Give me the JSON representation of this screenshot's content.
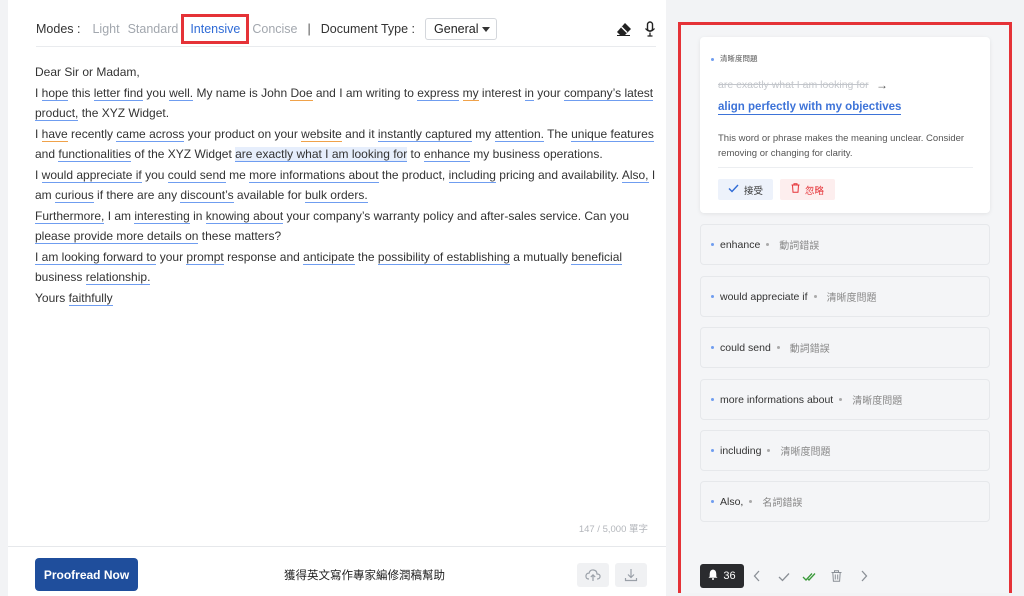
{
  "toolbar": {
    "modes_label": "Modes :",
    "modes": [
      {
        "label": "Light"
      },
      {
        "label": "Standard"
      },
      {
        "label": "Intensive",
        "active": true
      },
      {
        "label": "Concise"
      }
    ],
    "separator": "|",
    "doc_type_label": "Document Type :",
    "doc_type_value": "General",
    "icons": [
      "eraser-icon",
      "microphone-icon"
    ]
  },
  "document": {
    "greeting": "Dear Sir or Madam,",
    "lines": {
      "l1a": "I ",
      "l1b": "hope",
      "l1c": " this ",
      "l1d": "letter find",
      "l1e": " you ",
      "l1f": "well.",
      "l1g": " My name is John ",
      "l1h": "Doe",
      "l1i": " and I am writing to ",
      "l1j": "express",
      "l1k": " ",
      "l1l": "my",
      "l1m": " interest ",
      "l1n": "in",
      "l1o": " your ",
      "l1p": "company’s latest product,",
      "l1q": " the XYZ Widget.",
      "l2a": "I ",
      "l2b": "have",
      "l2c": " recently ",
      "l2d": "came across",
      "l2e": " your product on your ",
      "l2f": "website",
      "l2g": " and it ",
      "l2h": "instantly captured",
      "l2i": " my ",
      "l2j": "attention.",
      "l2k": " The ",
      "l2l": "unique features",
      "l2m": " and ",
      "l2n": "functionalities",
      "l2o": " of the XYZ Widget ",
      "l2p": "are exactly what I am looking for",
      "l2q": " to ",
      "l2r": "enhance",
      "l2s": " my business operations.",
      "l3a": "I ",
      "l3b": "would appreciate if",
      "l3c": " you ",
      "l3d": "could send",
      "l3e": " me ",
      "l3f": "more informations about",
      "l3g": " the product, ",
      "l3h": "including",
      "l3i": " pricing and availability. ",
      "l3j": "Also,",
      "l3k": " I am ",
      "l3l": "curious",
      "l3m": " if there are any ",
      "l3n": "discount’s",
      "l3o": " available for ",
      "l3p": "bulk orders.",
      "l4a": "Furthermore,",
      "l4b": " I am ",
      "l4c": "interesting",
      "l4d": " in ",
      "l4e": "knowing about",
      "l4f": " your company’s warranty policy and after-sales service. Can you ",
      "l4g": "please provide more details on",
      "l4h": " these matters?",
      "l5a": "I am looking forward to",
      "l5b": " your ",
      "l5c": "prompt",
      "l5d": " response and ",
      "l5e": "anticipate",
      "l5f": " the ",
      "l5g": "possibility of establishing",
      "l5h": " a mutually ",
      "l5i": "beneficial",
      "l5j": " business ",
      "l5k": "relationship.",
      "l6a": "Yours ",
      "l6b": "faithfully"
    }
  },
  "counter": "147 / 5,000 單字",
  "bottom": {
    "proofread_button": "Proofread Now",
    "expert_help": "獲得英文寫作專家編修潤稿幫助",
    "icons": [
      "cloud-upload-icon",
      "download-icon"
    ]
  },
  "panel": {
    "active_card": {
      "category": "清晰度問題",
      "original": "are exactly what I am looking for",
      "arrow": "→",
      "suggestion": "align perfectly with my objectives",
      "description": "This word or phrase makes the meaning unclear. Consider removing or changing for clarity.",
      "accept_label": "接受",
      "ignore_label": "忽略"
    },
    "issues": [
      {
        "text": "enhance",
        "kind": "動詞錯誤"
      },
      {
        "text": "would appreciate if",
        "kind": "清晰度問題"
      },
      {
        "text": "could send",
        "kind": "動詞錯誤"
      },
      {
        "text": "more informations about",
        "kind": "清晰度問題"
      },
      {
        "text": "including",
        "kind": "清晰度問題"
      },
      {
        "text": "Also,",
        "kind": "名詞錯誤"
      }
    ],
    "issue_count": "36",
    "nav_icons": [
      "chevron-left-icon",
      "check-icon",
      "double-check-icon",
      "trash-icon",
      "chevron-right-icon"
    ]
  },
  "colors": {
    "accent": "#2f6bd6",
    "primary_button": "#1f4e9c",
    "highlight_border": "#e53237",
    "underline_blue": "#6f9df0",
    "underline_orange": "#f0a24a"
  }
}
